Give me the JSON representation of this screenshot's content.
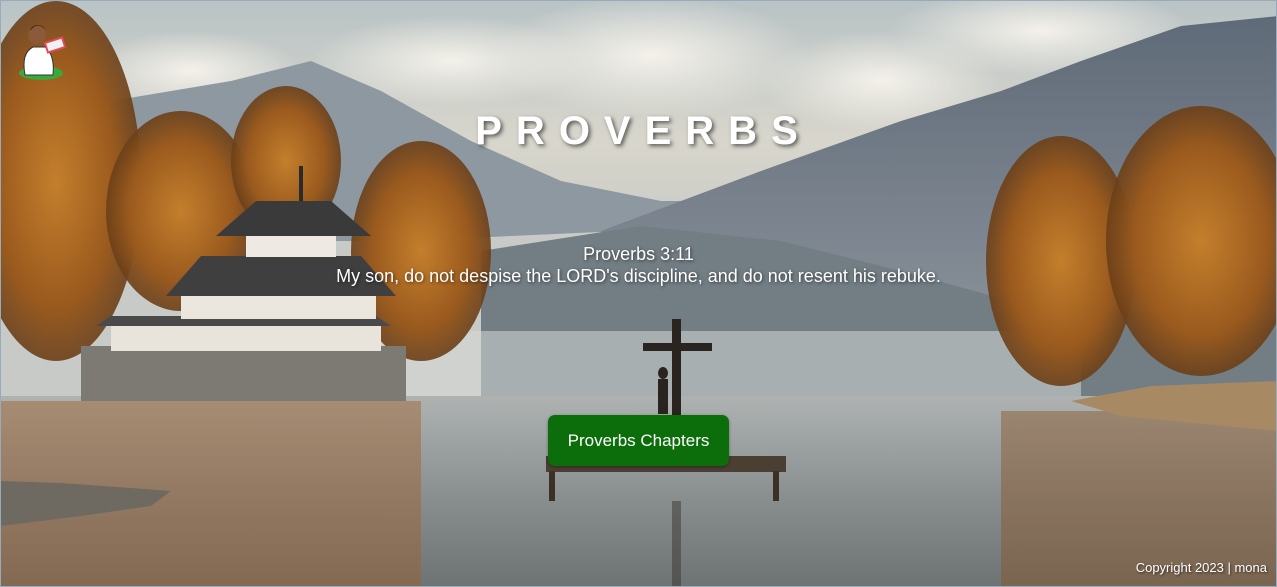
{
  "header": {
    "title": "PROVERBS"
  },
  "verse": {
    "reference": "Proverbs 3:11",
    "text": "My son, do not despise the LORD's discipline, and do not resent his rebuke."
  },
  "actions": {
    "chapters_button_label": "Proverbs Chapters"
  },
  "footer": {
    "copyright": "Copyright 2023 | mona"
  },
  "colors": {
    "button_bg": "#0b6e0b",
    "text": "#ffffff"
  },
  "icons": {
    "logo": "reader-logo-icon",
    "background": "lake-mountain-landscape-image"
  }
}
